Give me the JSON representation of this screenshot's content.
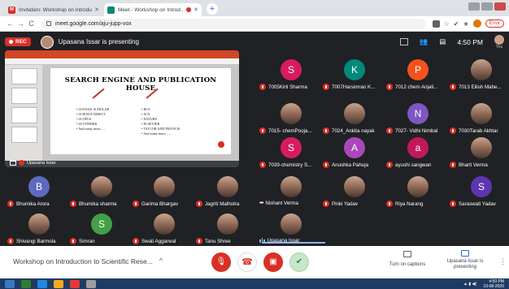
{
  "browser": {
    "tabs": [
      {
        "title": "Invitation: Workshop on Introdu...",
        "favicon": "gmail-icon",
        "fav_color": "#d93025",
        "fav_letter": "M",
        "active": false
      },
      {
        "title": "Meet - Workshop on Introd...",
        "favicon": "meet-icon",
        "fav_color": "#00897b",
        "fav_letter": "",
        "active": true,
        "recording": true
      }
    ],
    "new_tab": "+",
    "url": "meet.google.com/aju-jupp-vox",
    "error_label": "Error"
  },
  "meet_top": {
    "rec_label": "REC",
    "presenting_text": "Upasana Issar is presenting",
    "time": "4:50 PM",
    "you_label": "You"
  },
  "presentation": {
    "slide_title": "SEARCH ENGINE AND PUBLICATION HOUSE",
    "left_items": [
      "GOOGLE SCHOLAR",
      "SCIENCE DIRECT",
      "SCOPUS",
      "SCI FINDER",
      "And many more......"
    ],
    "right_items": [
      "RCS",
      "ACS",
      "NATURE",
      "ELSEVIER",
      "TAYLOR AND FRANCIS",
      "And many more......"
    ],
    "presenter_label": "Upasana Issar"
  },
  "participants": [
    {
      "name": "7005Kirti Sharma",
      "letter": "S",
      "color": "#d81b60",
      "kind": "letter",
      "status": "muted"
    },
    {
      "name": "7007Harsimran K...",
      "letter": "K",
      "color": "#00897b",
      "kind": "letter",
      "status": "muted"
    },
    {
      "name": "7012 chem Anjali...",
      "letter": "P",
      "color": "#f4511e",
      "kind": "letter",
      "status": "muted"
    },
    {
      "name": "7013 Eilish Mahe...",
      "letter": "",
      "color": "#8d6e63",
      "kind": "photo",
      "status": "muted"
    },
    {
      "name": "7015- chemPooja...",
      "letter": "",
      "color": "#8d6e63",
      "kind": "photo",
      "status": "muted"
    },
    {
      "name": "7024_Ankita nayak",
      "letter": "",
      "color": "#8d6e63",
      "kind": "photo",
      "status": "muted"
    },
    {
      "name": "7027- Vidhi Nimbal",
      "letter": "N",
      "color": "#7e57c2",
      "kind": "letter",
      "status": "muted"
    },
    {
      "name": "7030Tarab Akhtar",
      "letter": "",
      "color": "#8d6e63",
      "kind": "photo",
      "status": "muted"
    },
    {
      "name": "7039-chemistry S...",
      "letter": "S",
      "color": "#d81b60",
      "kind": "letter",
      "status": "muted"
    },
    {
      "name": "Anushka Pahuja",
      "letter": "A",
      "color": "#ab47bc",
      "kind": "letter",
      "status": "muted"
    },
    {
      "name": "ayushi sangwan",
      "letter": "a",
      "color": "#c2185b",
      "kind": "letter",
      "status": "muted"
    },
    {
      "name": "Bharti Verma",
      "letter": "",
      "color": "#8d6e63",
      "kind": "photo",
      "status": "muted"
    },
    {
      "name": "Bhumika Arora",
      "letter": "B",
      "color": "#5c6bc0",
      "kind": "letter",
      "status": "muted"
    },
    {
      "name": "Bhumika sharma",
      "letter": "",
      "color": "#8d6e63",
      "kind": "photo",
      "status": "muted"
    },
    {
      "name": "Garima Bhargav",
      "letter": "",
      "color": "#8d6e63",
      "kind": "photo",
      "status": "muted"
    },
    {
      "name": "Jagriti Malhotra",
      "letter": "",
      "color": "#8d6e63",
      "kind": "photo",
      "status": "muted"
    },
    {
      "name": "Nishant Verma",
      "letter": "",
      "color": "#8d6e63",
      "kind": "photo",
      "status": "dots"
    },
    {
      "name": "Pinki Yadav",
      "letter": "",
      "color": "#8d6e63",
      "kind": "photo",
      "status": "muted"
    },
    {
      "name": "Riya Narang",
      "letter": "",
      "color": "#8d6e63",
      "kind": "photo",
      "status": "muted"
    },
    {
      "name": "Saraswati Yadav",
      "letter": "S",
      "color": "#5e35b1",
      "kind": "letter",
      "status": "muted"
    },
    {
      "name": "Shivangi Barmola",
      "letter": "",
      "color": "#8d6e63",
      "kind": "photo",
      "status": "muted"
    },
    {
      "name": "Simran",
      "letter": "S",
      "color": "#43a047",
      "kind": "letter",
      "status": "muted"
    },
    {
      "name": "Swati Aggarwal",
      "letter": "",
      "color": "#8d6e63",
      "kind": "photo",
      "status": "muted"
    },
    {
      "name": "Tanu Shree",
      "letter": "",
      "color": "#8d6e63",
      "kind": "photo",
      "status": "muted"
    },
    {
      "name": "Upasana Issar",
      "letter": "",
      "color": "#8d6e63",
      "kind": "photo",
      "status": "speaking"
    }
  ],
  "bottom": {
    "meeting_title": "Workshop on Introduction to Scientific Rese...",
    "captions_label": "Turn on captions",
    "presenting_label": "Upasana Issar is presenting"
  },
  "taskbar": {
    "time": "4:50 PM",
    "date": "10-08-2020"
  }
}
